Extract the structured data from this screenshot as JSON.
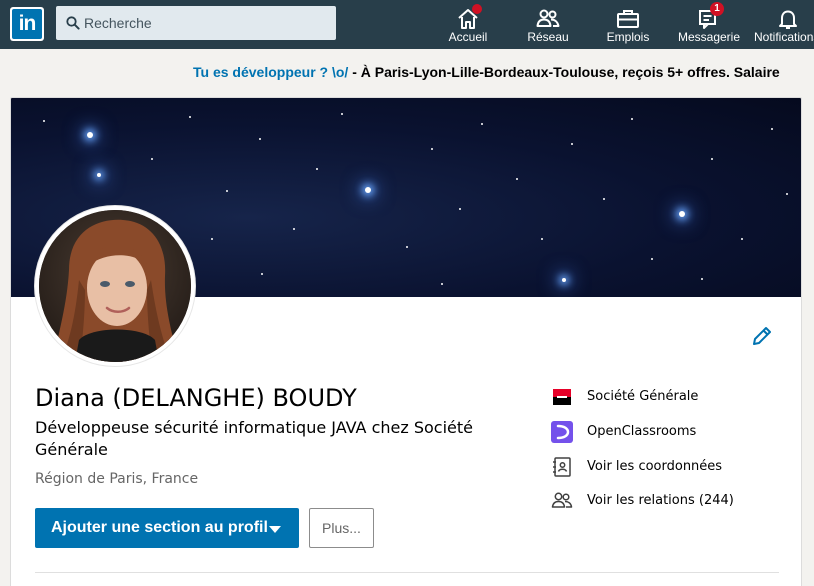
{
  "nav": {
    "logo_text": "in",
    "search_placeholder": "Recherche",
    "items": [
      {
        "label": "Accueil",
        "icon": "home-icon",
        "badge": ""
      },
      {
        "label": "Réseau",
        "icon": "people-icon",
        "badge": ""
      },
      {
        "label": "Emplois",
        "icon": "briefcase-icon",
        "badge": ""
      },
      {
        "label": "Messagerie",
        "icon": "message-icon",
        "badge": "1"
      },
      {
        "label": "Notifications",
        "icon": "bell-icon",
        "badge": ""
      }
    ]
  },
  "promo": {
    "link_text": "Tu es développeur ? \\o/",
    "text": " - À Paris-Lyon-Lille-Bordeaux-Toulouse, reçois 5+ offres. Salaire"
  },
  "profile": {
    "name": "Diana (DELANGHE) BOUDY",
    "headline": "Développeuse sécurité informatique JAVA chez Société Générale",
    "location": "Région de Paris, France",
    "add_section_label": "Ajouter une section au profil",
    "more_label": "Plus..."
  },
  "sidebar": {
    "company": "Société Générale",
    "school": "OpenClassrooms",
    "contact_info": "Voir les coordonnées",
    "connections": "Voir les relations (244)"
  },
  "colors": {
    "nav_bg": "#283e4a",
    "accent": "#0073b1",
    "badge": "#d11124",
    "societe_generale_red": "#e60028",
    "openclassrooms_purple": "#7451eb"
  }
}
